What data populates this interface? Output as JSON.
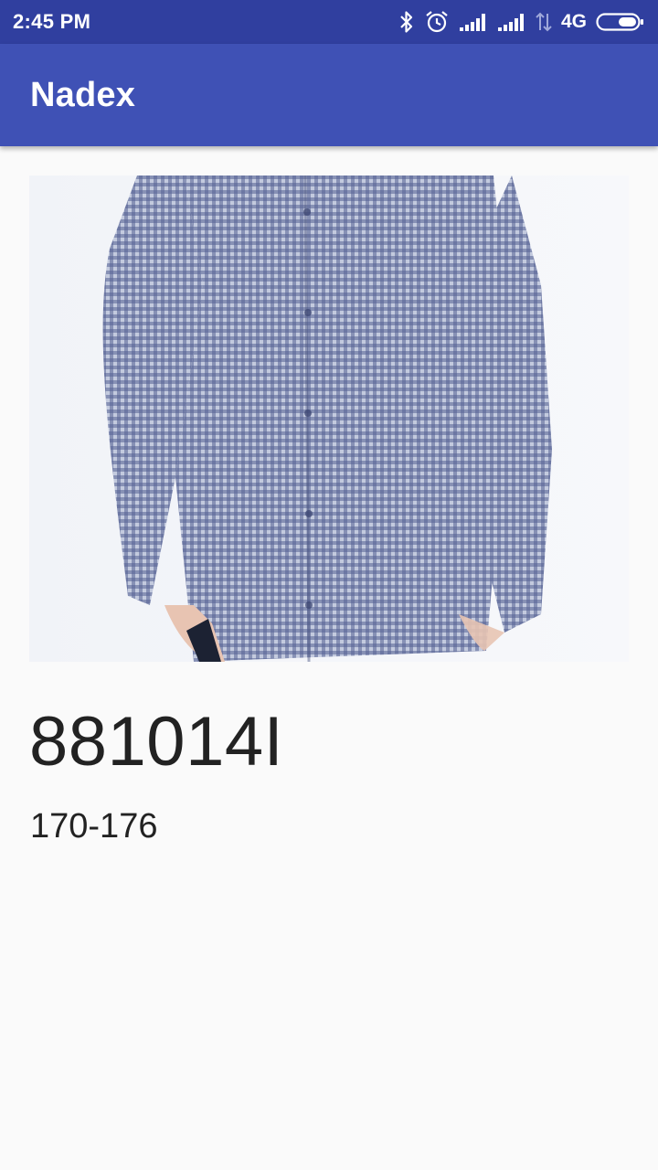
{
  "status_bar": {
    "time": "2:45 PM",
    "network": "4G",
    "icons": [
      "bluetooth-icon",
      "alarm-icon",
      "signal-icon",
      "signal-icon",
      "data-arrows-icon",
      "battery-icon"
    ]
  },
  "app_bar": {
    "title": "Nadex"
  },
  "product": {
    "image_description": "checked-shirt-photo",
    "code": "881014I",
    "size": "170-176"
  },
  "colors": {
    "status_bar": "#303f9f",
    "app_bar": "#3f51b5",
    "background": "#fafafa",
    "text": "#222222"
  }
}
